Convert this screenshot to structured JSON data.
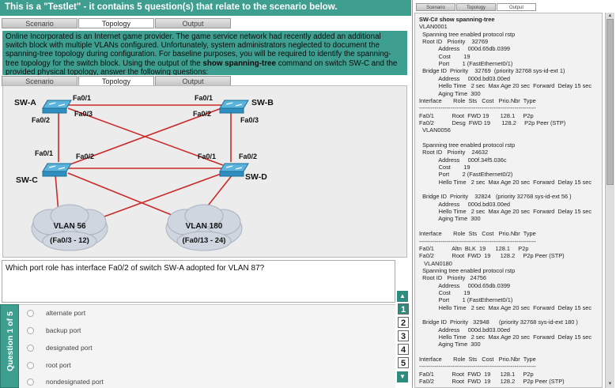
{
  "header": {
    "title": "This is a \"Testlet\" - it contains 5 question(s) that relate to the scenario below."
  },
  "tabs": [
    "Scenario",
    "Topology",
    "Output"
  ],
  "scenario": {
    "text_pre": "Online Incorporated is an Internet game provider.  The game service network had recently added an additional switch block with multiple VLANs configured. Unfortunately, system administrators neglected to document the spanning-tree topology during configuration.  For baseline purposes, you will be required to identify the spanning-tree topology for the switch block.  Using the output of the ",
    "cmd": "show spanning-tree",
    "text_post": " command on switch SW-C and the provided physical topology, answer the following questions:"
  },
  "topology": {
    "switches": {
      "swa": "SW-A",
      "swb": "SW-B",
      "swc": "SW-C",
      "swd": "SW-D"
    },
    "ports": {
      "a1": "Fa0/1",
      "a2": "Fa0/2",
      "a3": "Fa0/3",
      "b1": "Fa0/1",
      "b2": "Fa0/2",
      "b3": "Fa0/3",
      "c1": "Fa0/1",
      "c2": "Fa0/2",
      "d1": "Fa0/1",
      "d2": "Fa0/2"
    },
    "clouds": [
      {
        "name": "VLAN 56",
        "range": "(Fa0/3 - 12)"
      },
      {
        "name": "VLAN 180",
        "range": "(Fa0/13 - 24)"
      }
    ]
  },
  "question": {
    "text": "Which port role has interface Fa0/2 of switch SW-A adopted for VLAN 87?",
    "counter": "Question 1 of 5"
  },
  "answers": [
    "alternate port",
    "backup port",
    "designated port",
    "root port",
    "nondesignated port"
  ],
  "nav": {
    "numbers": [
      "1",
      "2",
      "3",
      "4",
      "5"
    ],
    "up": "▲",
    "down": "▼"
  },
  "output": {
    "lines": [
      "SW-C# show spanning-tree",
      "VLAN0001",
      "  Spanning tree enabled protocol rstp",
      "  Root ID   Priority    32769",
      "            Address     000d.65db.0399",
      "            Cost        19",
      "            Port        1 (FastEthernet0/1)",
      "  Bridge ID  Priority    32769  (priority 32768 sys-id-ext 1)",
      "            Address     000d.bd03.00ed",
      "            Hello Time   2 sec  Max Age 20 sec  Forward  Delay 15 sec",
      "            Aging Time  300",
      "Interface       Role  Sts   Cost   Prio.Nbr  Type",
      "------------------------------------------------------------",
      "Fa0/1           Root  FWD 19       128.1     P2p",
      "Fa0/2           Desg  FWD 19       128.2     P2p Peer (STP)",
      "  VLAN0056",
      "",
      "  Spanning tree enabled protocol rstp",
      "  Root ID   Priority    24632",
      "            Address     000f.34f5.036c",
      "            Cost        19",
      "            Port        2 (FastEthernet0/2)",
      "            Hello Time   2 sec  Max Age 20 sec  Forward  Delay 15 sec",
      "",
      "  Bridge ID  Priority    32824   (priority 32768 sys-id-ext 56 )",
      "            Address     000d.bd03.00ed",
      "            Hello Time   2 sec  Max Age 20 sec  Forward  Delay 15 sec",
      "            Aging Time  300",
      "",
      "Interface       Role  Sts   Cost   Prio.Nbr  Type",
      "------------------------------------------------------------",
      "Fa0/1           Altn  BLK  19      128.1     P2p",
      "Fa0/2           Root  FWD  19      128.2     P2p Peer (STP)",
      "   VLAN0180",
      "  Spanning tree enabled protocol rstp",
      "  Root ID   Priority   24756",
      "            Address     000d.65db.0399",
      "            Cost        19",
      "            Port        1 (FastEthernet0/1)",
      "            Hello Time   2 sec  Max Age 20 sec  Forward  Delay 15 sec",
      "",
      "  Bridge ID  Priority   32948      (priority 32768 sys-id-ext 180 )",
      "            Address     000d.bd03.00ed",
      "            Hello Time   2 sec  Max Age 20 sec  Forward  Delay 15 sec",
      "            Aging Time  300",
      "",
      "Interface       Role  Sts   Cost   Prio.Nbr  Type",
      "------------------------------------------------------------",
      "Fa0/1           Root  FWD  19      128.1     P2p",
      "Fa0/2           Root  FWD  19      128.2     P2p Peer (STP)"
    ]
  },
  "colors": {
    "accent": "#3e9e8f",
    "link": "#cc2a2a",
    "switch": "#2e8fc0"
  }
}
